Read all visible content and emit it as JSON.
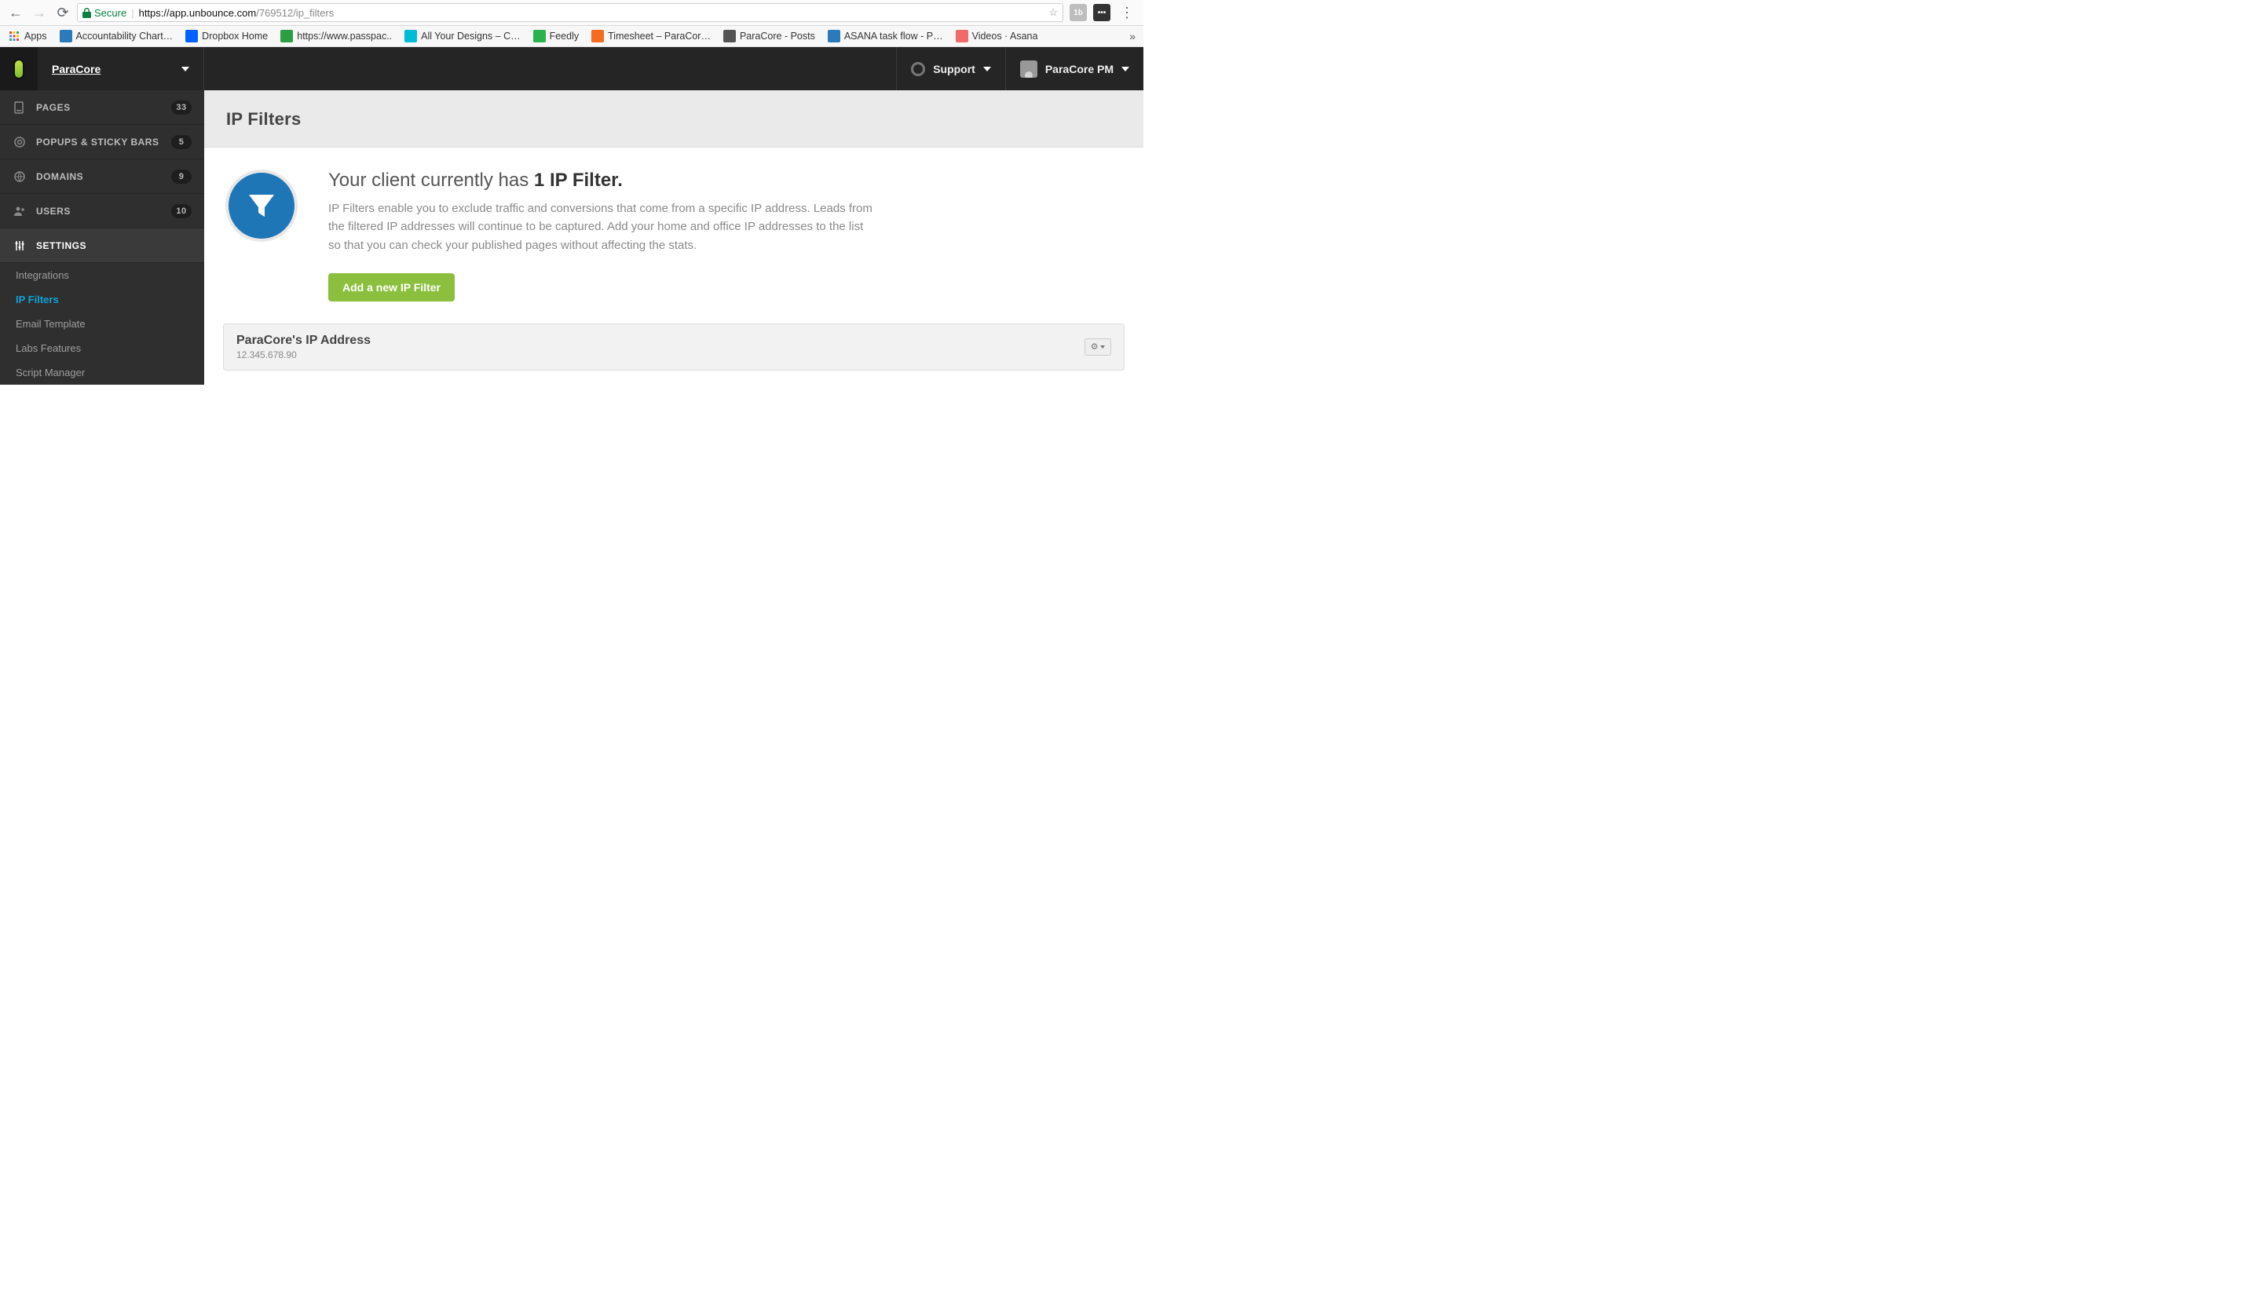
{
  "browser": {
    "secure_label": "Secure",
    "url_host": "https://app.unbounce.com",
    "url_path": "/769512/ip_filters",
    "bookmarks": [
      {
        "label": "Apps",
        "color": "#ffffff",
        "grid": true
      },
      {
        "label": "Accountability Chart…",
        "color": "#2b7bba"
      },
      {
        "label": "Dropbox Home",
        "color": "#0061fe"
      },
      {
        "label": "https://www.passpac..",
        "color": "#2e9e44"
      },
      {
        "label": "All Your Designs – C…",
        "color": "#00bcd4"
      },
      {
        "label": "Feedly",
        "color": "#2bb24c"
      },
      {
        "label": "Timesheet – ParaCor…",
        "color": "#f56b1f"
      },
      {
        "label": "ParaCore - Posts",
        "color": "#555555"
      },
      {
        "label": "ASANA task flow - P…",
        "color": "#2b7bba"
      },
      {
        "label": "Videos · Asana",
        "color": "#f06a6a"
      }
    ]
  },
  "topbar": {
    "client": "ParaCore",
    "support": "Support",
    "user": "ParaCore PM"
  },
  "sidebar": {
    "items": [
      {
        "label": "PAGES",
        "count": "33"
      },
      {
        "label": "POPUPS & STICKY BARS",
        "count": "5"
      },
      {
        "label": "DOMAINS",
        "count": "9"
      },
      {
        "label": "USERS",
        "count": "10"
      },
      {
        "label": "SETTINGS",
        "count": ""
      }
    ],
    "subs": [
      {
        "label": "Integrations"
      },
      {
        "label": "IP Filters"
      },
      {
        "label": "Email Template"
      },
      {
        "label": "Labs Features"
      },
      {
        "label": "Script Manager"
      }
    ]
  },
  "page": {
    "title": "IP Filters",
    "heading_prefix": "Your client currently has ",
    "heading_bold": "1 IP Filter.",
    "description": "IP Filters enable you to exclude traffic and conversions that come from a specific IP address. Leads from the filtered IP addresses will continue to be captured. Add your home and office IP addresses to the list so that you can check your published pages without affecting the stats.",
    "add_button": "Add a new IP Filter"
  },
  "filters": [
    {
      "name": "ParaCore's IP Address",
      "ip": "12.345.678.90"
    }
  ]
}
